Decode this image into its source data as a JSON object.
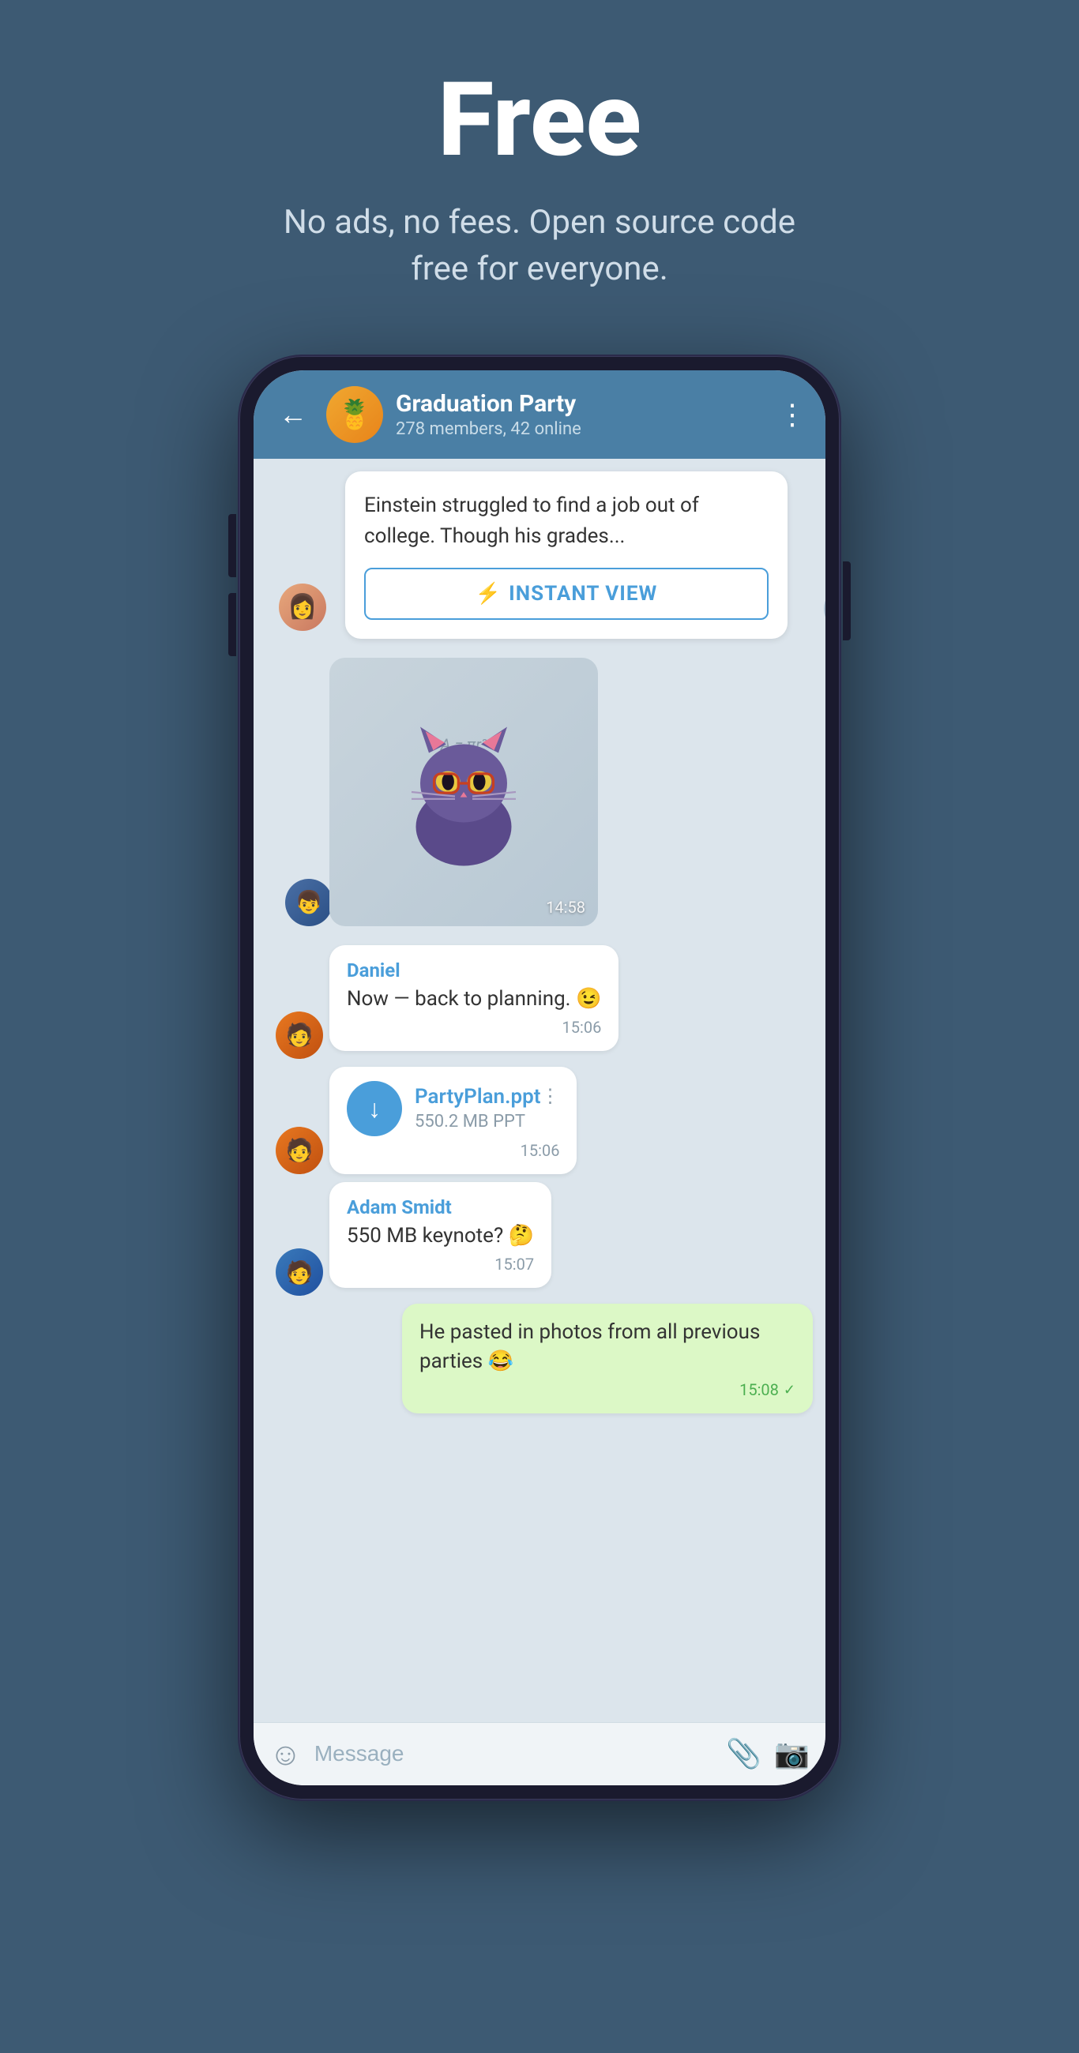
{
  "hero": {
    "title": "Free",
    "subtitle": "No ads, no fees. Open source code free for everyone."
  },
  "chat": {
    "header": {
      "back_label": "←",
      "group_name": "Graduation Party",
      "group_members": "278 members, 42 online",
      "group_avatar_emoji": "🍍",
      "menu_icon": "⋮"
    },
    "messages": [
      {
        "id": "article",
        "type": "article",
        "text": "Einstein struggled to find a job out of college. Though his grades...",
        "instant_view_label": "INSTANT VIEW",
        "instant_view_icon": "⚡"
      },
      {
        "id": "sticker",
        "type": "sticker",
        "time": "14:58",
        "sticker": "🐱"
      },
      {
        "id": "daniel-msg",
        "type": "text",
        "sender": "Daniel",
        "text": "Now — back to planning. 😉",
        "time": "15:06"
      },
      {
        "id": "file-msg",
        "type": "file",
        "file_name": "PartyPlan.ppt",
        "file_size": "550.2 MB PPT",
        "time": "15:06",
        "menu_icon": "⋮"
      },
      {
        "id": "adam-msg",
        "type": "text",
        "sender": "Adam Smidt",
        "text": "550 MB keynote? 🤔",
        "time": "15:07"
      },
      {
        "id": "own-msg",
        "type": "text",
        "own": true,
        "text": "He pasted in photos from all previous parties 😂",
        "time": "15:08",
        "check": "✓"
      }
    ],
    "input": {
      "placeholder": "Message",
      "emoji_icon": "☺",
      "attach_icon": "📎",
      "camera_icon": "📷"
    }
  },
  "colors": {
    "header_bg": "#4a7fa5",
    "chat_bg": "#dce5ec",
    "own_msg_bg": "#dcf8c6",
    "accent": "#4a9eda"
  }
}
